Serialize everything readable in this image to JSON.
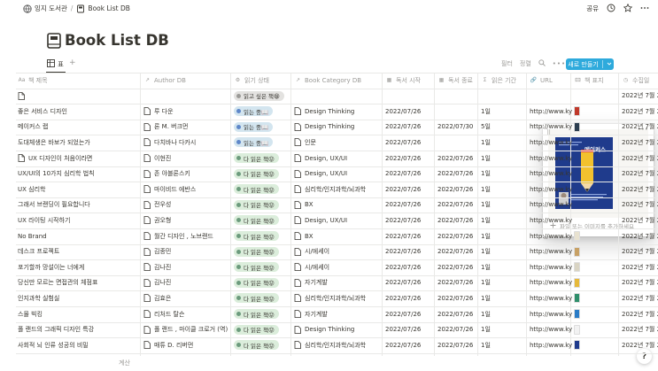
{
  "breadcrumb": {
    "workspace": "잉지 도서관",
    "separator": "/",
    "page": "Book List DB"
  },
  "topbar": {
    "share": "공유"
  },
  "page": {
    "title": "Book List DB"
  },
  "view": {
    "tab_label": "표",
    "add": "+",
    "filter": "필터",
    "sort": "정렬",
    "new_button": "새로 만들기"
  },
  "columns": [
    "책 제목",
    "Author DB",
    "읽기 상태",
    "Book Category DB",
    "독서 시작",
    "독서 종료",
    "읽은 기간",
    "URL",
    "책 표지",
    "수집일"
  ],
  "rows": [
    {
      "title": "",
      "author": "",
      "status": "읽고 싶은 책😁",
      "status_type": "todo",
      "category": "",
      "start": "",
      "end": "",
      "period": "",
      "url": "",
      "cover": "",
      "collected": "2022년 7월 2"
    },
    {
      "title": "좋은 서비스 디자인",
      "author": "루 다운",
      "status": "읽는 중📖",
      "status_type": "reading",
      "category": "Design Thinking",
      "start": "2022/07/26",
      "end": "",
      "period": "1일",
      "url": "http://www.kyo",
      "cover": "#c0392b",
      "collected": "2022년 7월 2"
    },
    {
      "title": "메이커스 랩",
      "author": "론 M. 버크먼",
      "status": "읽는 중📖",
      "status_type": "reading",
      "category": "Design Thinking",
      "start": "2022/07/26",
      "end": "2022/07/30",
      "period": "5일",
      "url": "http://www.kyo",
      "cover": "#2c3e50",
      "collected": "2022년 7월 2"
    },
    {
      "title": "도대체생은 바보가 되었는가",
      "author": "다치바나 다카시",
      "status": "읽는 중📖",
      "status_type": "reading",
      "category": "인문",
      "start": "2022/07/26",
      "end": "",
      "period": "1일",
      "url": "http://www.kyo",
      "cover": "",
      "collected": "2022년 7월 2"
    },
    {
      "title": "UX 디자인이 처음이라면",
      "author": "이현진",
      "status": "다 읽은 책😝",
      "status_type": "done",
      "category": "Design, UX/UI",
      "start": "2022/07/26",
      "end": "2022/07/26",
      "period": "1일",
      "url": "http://www.kyo",
      "cover": "",
      "collected": "2022년 7월 2"
    },
    {
      "title": "UX/UI의 10가지 심리학 법칙",
      "author": "존 야블론스키",
      "status": "다 읽은 책😝",
      "status_type": "done",
      "category": "Design, UX/UI",
      "start": "2022/07/26",
      "end": "2022/07/26",
      "period": "1일",
      "url": "http://www.kyo",
      "cover": "",
      "collected": "2022년 7월 2"
    },
    {
      "title": "UX 심리학",
      "author": "마이비드 에반스",
      "status": "다 읽은 책😝",
      "status_type": "done",
      "category": "심리학/인지과학/뇌과학",
      "start": "2022/07/26",
      "end": "2022/07/26",
      "period": "1일",
      "url": "http://www.kyo",
      "cover": "",
      "collected": "2022년 7월 2"
    },
    {
      "title": "그래서 브랜딩이 필요합니다",
      "author": "전우성",
      "status": "다 읽은 책😝",
      "status_type": "done",
      "category": "BX",
      "start": "2022/07/26",
      "end": "2022/07/26",
      "period": "1일",
      "url": "http://www.kyo",
      "cover": "",
      "collected": "2022년 7월 2"
    },
    {
      "title": "UX 라이팅 시작하기",
      "author": "권오형",
      "status": "다 읽은 책😝",
      "status_type": "done",
      "category": "Design, UX/UI",
      "start": "2022/07/26",
      "end": "2022/07/26",
      "period": "1일",
      "url": "http://www.kyo",
      "cover": "",
      "collected": "2022년 7월 2"
    },
    {
      "title": "No Brand",
      "author": "월간 디자인 , 노브랜드",
      "status": "다 읽은 책😝",
      "status_type": "done",
      "category": "BX",
      "start": "2022/07/26",
      "end": "2022/07/26",
      "period": "1일",
      "url": "http://www.kyo",
      "cover": "#e8e2d0",
      "collected": "2022년 7월 2"
    },
    {
      "title": "데스크 프로젝트",
      "author": "김종민",
      "status": "다 읽은 책😝",
      "status_type": "done",
      "category": "시/에세이",
      "start": "2022/07/26",
      "end": "2022/07/26",
      "period": "1일",
      "url": "http://www.kyo",
      "cover": "#c8a165",
      "collected": "2022년 7월 2"
    },
    {
      "title": "포기할까 망설이는 너에게",
      "author": "김나진",
      "status": "다 읽은 책😝",
      "status_type": "done",
      "category": "시/에세이",
      "start": "2022/07/26",
      "end": "2022/07/26",
      "period": "1일",
      "url": "http://www.kyo",
      "cover": "#d9d4c3",
      "collected": "2022년 7월 2"
    },
    {
      "title": "당신만 모르는 면접관의 체점표",
      "author": "김나진",
      "status": "다 읽은 책😝",
      "status_type": "done",
      "category": "자기계발",
      "start": "2022/07/26",
      "end": "2022/07/26",
      "period": "1일",
      "url": "http://www.kyo",
      "cover": "#e6b93a",
      "collected": "2022년 7월 2"
    },
    {
      "title": "인지과학 실험실",
      "author": "김효은",
      "status": "다 읽은 책😝",
      "status_type": "done",
      "category": "심리학/인지과학/뇌과학",
      "start": "2022/07/26",
      "end": "2022/07/26",
      "period": "1일",
      "url": "http://www.kyo",
      "cover": "#2f8f6b",
      "collected": "2022년 7월 2"
    },
    {
      "title": "스몰 빅킹",
      "author": "리처드 탈슨",
      "status": "다 읽은 책😝",
      "status_type": "done",
      "category": "자기계발",
      "start": "2022/07/26",
      "end": "2022/07/26",
      "period": "1일",
      "url": "http://www.kyo",
      "cover": "#2a7cc7",
      "collected": "2022년 7월 2"
    },
    {
      "title": "폴 랜드의 그래픽 디자인 특강",
      "author": "폴 랜드 , 마이클 크로거 (역)",
      "status": "다 읽은 책😝",
      "status_type": "done",
      "category": "Design Thinking",
      "start": "2022/07/26",
      "end": "2022/07/26",
      "period": "1일",
      "url": "http://www.kyo",
      "cover": "#f2f2f2",
      "collected": "2022년 7월 2"
    },
    {
      "title": "사회적 뇌 인류 성공의 비밀",
      "author": "매튜 D. 리버먼",
      "status": "다 읽은 책😝",
      "status_type": "done",
      "category": "심리학/인지과학/뇌과학",
      "start": "2022/07/26",
      "end": "2022/07/26",
      "period": "1일",
      "url": "http://www.kyo",
      "cover": "#1f3b8c",
      "collected": "2022년 7월 2"
    }
  ],
  "footer": {
    "calculate": "계산"
  },
  "popup": {
    "add_label": "파일 또는 이미지를 추가하세요",
    "cover_title": "메이커스 랩"
  },
  "help": "?",
  "colors": {
    "accent": "#2eaadc",
    "done": "#dbeddb",
    "reading": "#d3e5ef",
    "todo": "#e3e2e0"
  }
}
